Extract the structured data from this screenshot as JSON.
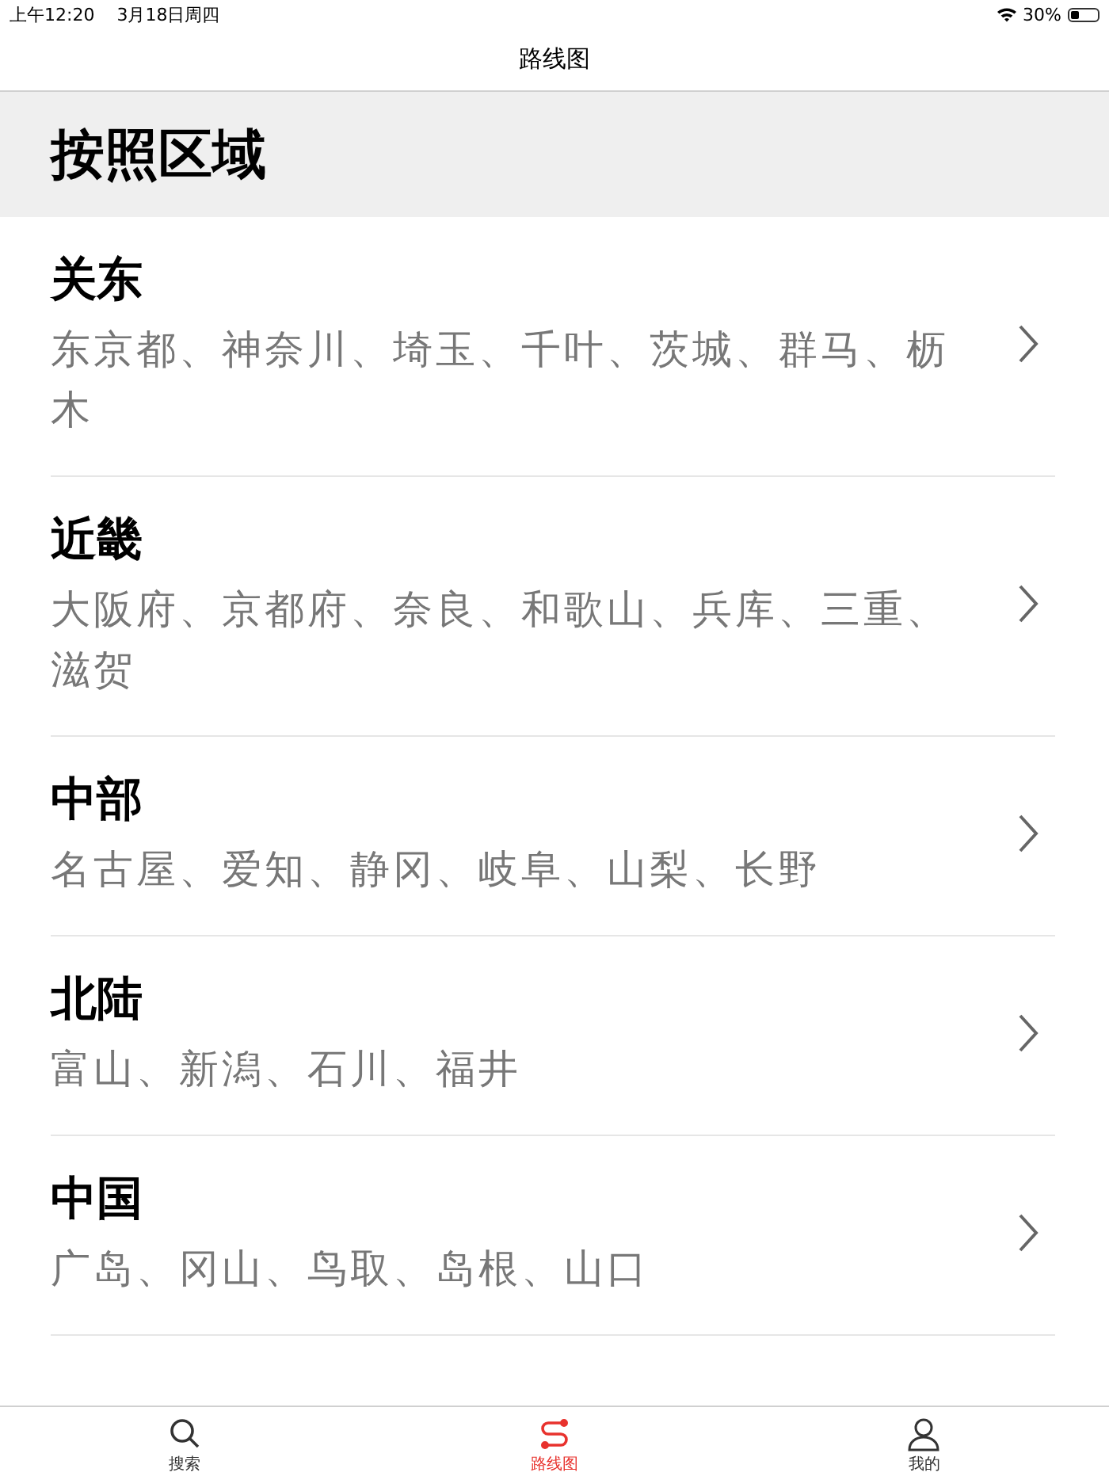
{
  "status_bar": {
    "time": "上午12:20",
    "date": "3月18日周四",
    "battery": "30%"
  },
  "nav": {
    "title": "路线图"
  },
  "section": {
    "title": "按照区域"
  },
  "regions": [
    {
      "name": "关东",
      "areas": "东京都、神奈川、埼玉、千叶、茨城、群马、枥木"
    },
    {
      "name": "近畿",
      "areas": "大阪府、京都府、奈良、和歌山、兵库、三重、滋贺"
    },
    {
      "name": "中部",
      "areas": "名古屋、爱知、静冈、岐阜、山梨、长野"
    },
    {
      "name": "北陆",
      "areas": "富山、新潟、石川、福井"
    },
    {
      "name": "中国",
      "areas": "广岛、冈山、鸟取、岛根、山口"
    }
  ],
  "tabs": [
    {
      "kind": "search",
      "label": "搜索",
      "selected": false
    },
    {
      "kind": "route",
      "label": "路线图",
      "selected": true
    },
    {
      "kind": "profile",
      "label": "我的",
      "selected": false
    }
  ]
}
